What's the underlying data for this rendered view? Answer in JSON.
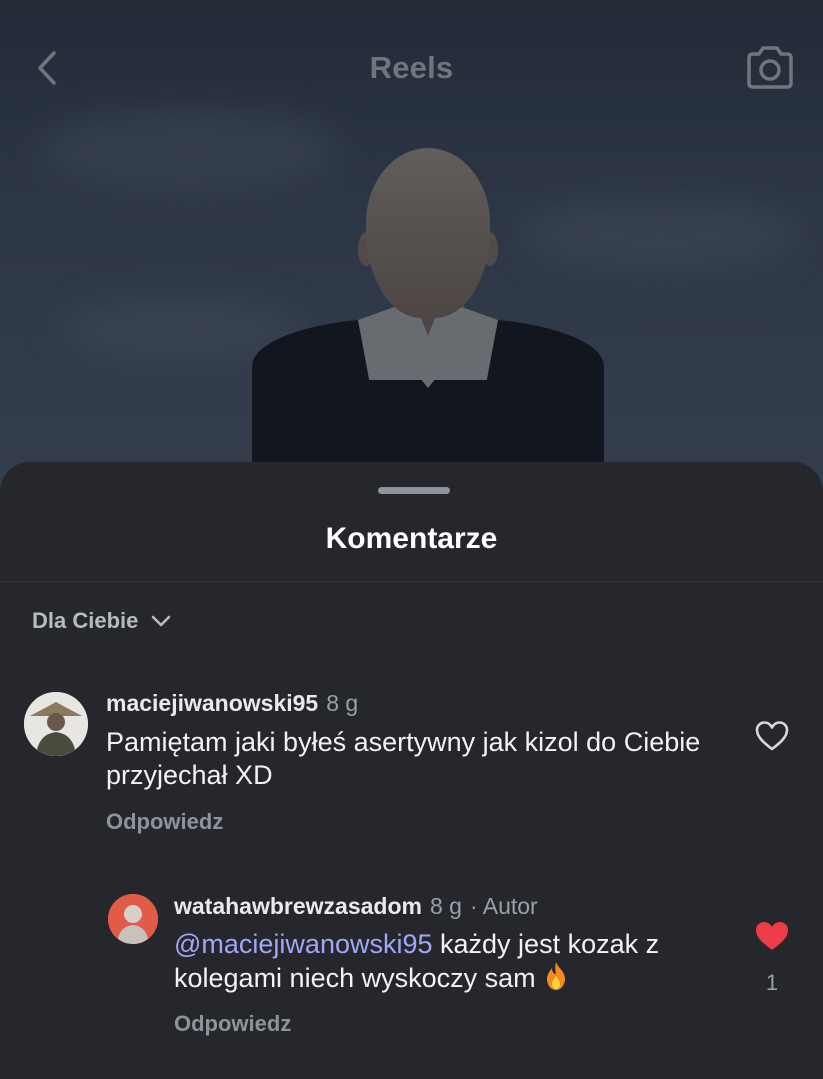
{
  "header": {
    "title": "Reels",
    "back_icon": "chevron-left-icon",
    "camera_icon": "camera-icon"
  },
  "sheet": {
    "title": "Komentarze",
    "sort_label": "Dla Ciebie",
    "sort_icon": "chevron-down-icon"
  },
  "comments": [
    {
      "username": "maciejiwanowski95",
      "time": "8 g",
      "text": "Pamiętam jaki byłeś asertywny jak kizol do Ciebie przyjechał XD",
      "reply_label": "Odpowiedz",
      "liked": false,
      "like_icon": "heart-outline-icon"
    },
    {
      "username": "watahawbrewzasadom",
      "time": "8 g",
      "meta": "· Autor",
      "mention": "@maciejiwanowski95",
      "text": " każdy jest kozak z kolegami niech wyskoczy sam",
      "emoji": "fire-icon",
      "reply_label": "Odpowiedz",
      "liked": true,
      "like_icon": "heart-filled-icon",
      "like_count": "1"
    }
  ],
  "colors": {
    "sheet_bg": "#25272c",
    "mention": "#a2a6f6",
    "like_active": "#ed3d48"
  }
}
